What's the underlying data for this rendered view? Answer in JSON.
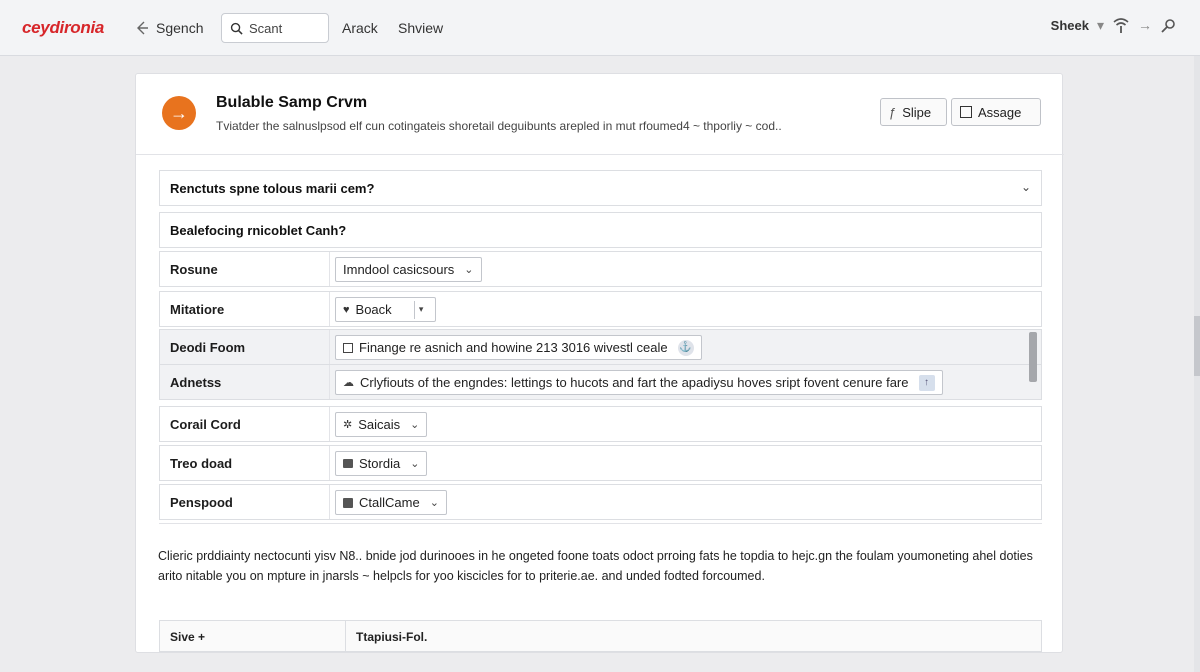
{
  "topbar": {
    "brand": "ceydironia",
    "nav_search": "Sgench",
    "search_placeholder": "Scant",
    "nav_items": [
      "Arack",
      "Shview"
    ],
    "user_label": "Sheek"
  },
  "card": {
    "title": "Bulable Samp Crvm",
    "subtitle": "Tviatder the salnuslpsod elf cun cotingateis shoretail deguibunts arepled in mut rfoumed4 ~ thporliy ~ cod..",
    "buttons": {
      "slipe": "Slipe",
      "assage": "Assage"
    },
    "question1": "Renctuts spne tolous marii cem?",
    "question2": "Bealefocing rnicoblet Canh?",
    "fields": [
      {
        "label": "Rosune",
        "value": "Imndool casicsours"
      },
      {
        "label": "Mitatiore",
        "value": "Boack"
      },
      {
        "label": "Deodi Foom",
        "value": "Finange re asnich and howine 213 3016 wivestl ceale"
      },
      {
        "label": "Adnetss",
        "value": "Crlyfiouts of the engndes: lettings to hucots and fart the apadiysu hoves sript fovent cenure fare"
      },
      {
        "label": "Corail Cord",
        "value": "Saicais"
      },
      {
        "label": "Treo doad",
        "value": "Stordia"
      },
      {
        "label": "Penspood",
        "value": "CtallCame"
      }
    ],
    "paragraph": "Clieric prddiainty nectocunti yisv N8.. bnide jod durinooes in he ongeted foone toats odoct prroing fats he topdia to hejc.gn the foulam youmoneting ahel doties arito nitable you on mpture in jnarsls ~ helpcls for yoo kiscicles for to priterie.ae. and unded fodted forcoumed.",
    "footer": {
      "col1": "Sive +",
      "col2": "Ttapiusi-Fol."
    }
  },
  "colors": {
    "brand": "#d7262a",
    "avatar": "#e8731e"
  }
}
